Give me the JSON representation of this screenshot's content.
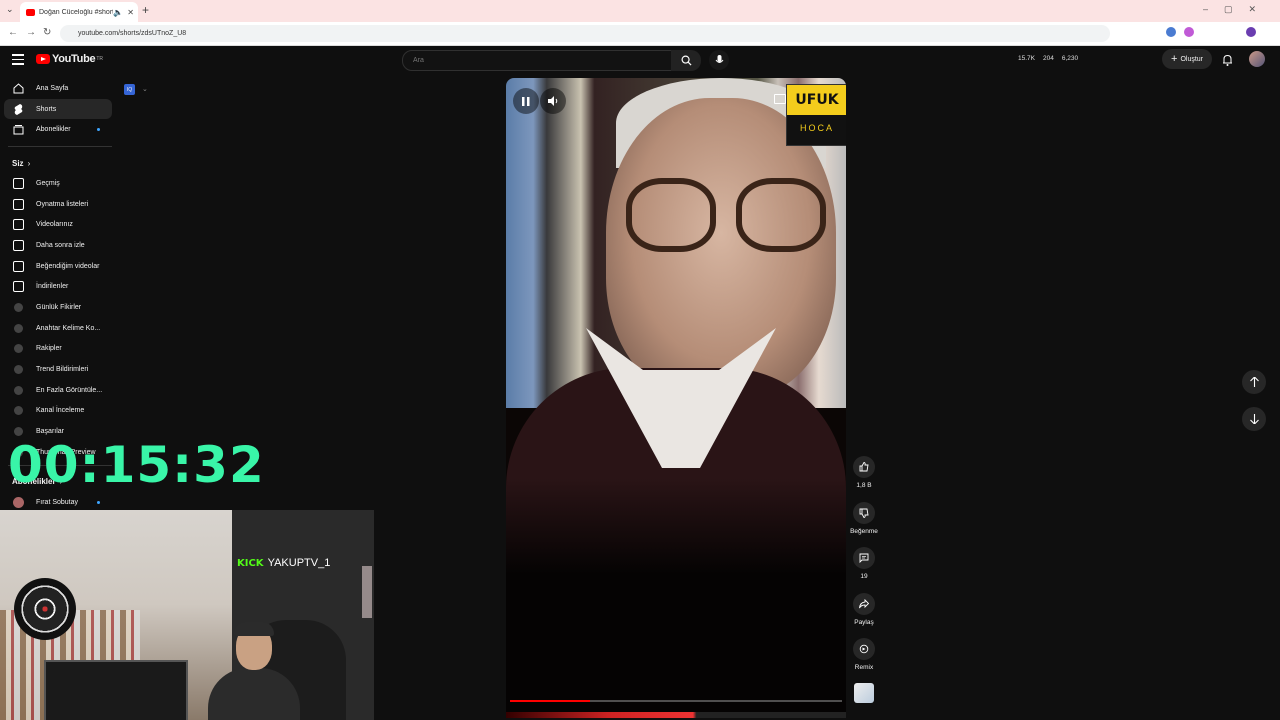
{
  "browser": {
    "tab_title": "Doğan Cüceloğlu #shorts",
    "url": "youtube.com/shorts/zdsUTnoZ_U8"
  },
  "youtube": {
    "logo_text": "YouTube",
    "logo_region": "TR",
    "search_placeholder": "Ara",
    "stats": {
      "views": "15.7K",
      "likes": "204",
      "subs": "6,230"
    },
    "create_label": "Oluştur"
  },
  "sidebar": {
    "main": [
      {
        "label": "Ana Sayfa",
        "icon": "home-icon"
      },
      {
        "label": "Shorts",
        "icon": "shorts-icon"
      },
      {
        "label": "Abonelikler",
        "icon": "subscriptions-icon"
      }
    ],
    "you_header": "Siz",
    "you_items": [
      {
        "label": "Geçmiş",
        "icon": "history-icon"
      },
      {
        "label": "Oynatma listeleri",
        "icon": "playlist-icon"
      },
      {
        "label": "Videolarınız",
        "icon": "your-videos-icon"
      },
      {
        "label": "Daha sonra izle",
        "icon": "watch-later-icon"
      },
      {
        "label": "Beğendiğim videolar",
        "icon": "liked-icon"
      },
      {
        "label": "İndirilenler",
        "icon": "download-icon"
      },
      {
        "label": "Günlük Fikirler",
        "icon": "ext-icon"
      },
      {
        "label": "Anahtar Kelime Ko...",
        "icon": "ext-icon"
      },
      {
        "label": "Rakipler",
        "icon": "ext-icon"
      },
      {
        "label": "Trend Bildirimleri",
        "icon": "ext-icon"
      },
      {
        "label": "En Fazla Görüntüle...",
        "icon": "ext-icon"
      },
      {
        "label": "Kanal İnceleme",
        "icon": "ext-icon"
      },
      {
        "label": "Başarılar",
        "icon": "ext-icon"
      },
      {
        "label": "Thumbnail Preview",
        "icon": "ext-icon"
      }
    ],
    "subs_header": "Abonelikler",
    "sub_item": "Fırat Sobutay",
    "filter_badge": "IQ"
  },
  "overlay": {
    "timer": "00:15:32",
    "kick_brand": "KICK",
    "kick_user": "YAKUPTV_1"
  },
  "video": {
    "brand_top": "UFUK",
    "brand_bottom": "HOCA",
    "progress": 0.24
  },
  "actions": {
    "likes": "1,8 B",
    "dislike": "Beğenme",
    "comments": "19",
    "share": "Paylaş",
    "remix": "Remix"
  }
}
